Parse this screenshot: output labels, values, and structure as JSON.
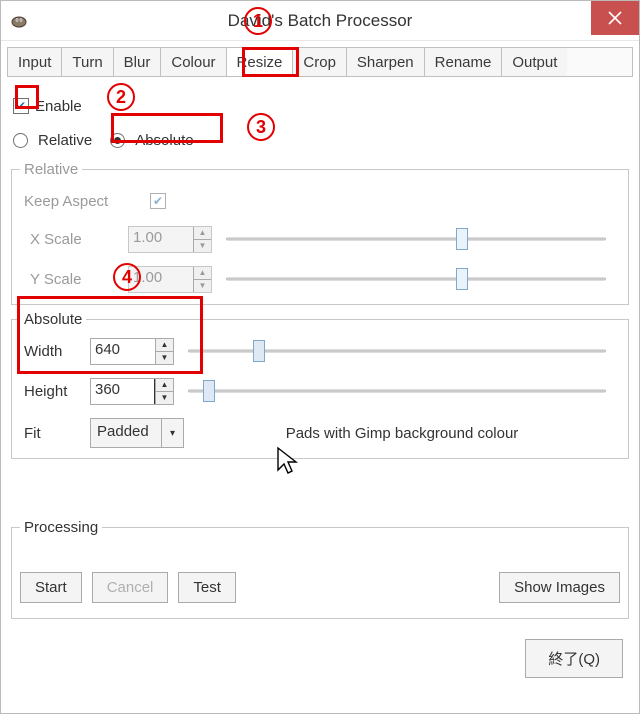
{
  "window": {
    "title": "David's Batch Processor"
  },
  "tabs": [
    "Input",
    "Turn",
    "Blur",
    "Colour",
    "Resize",
    "Crop",
    "Sharpen",
    "Rename",
    "Output"
  ],
  "active_tab": "Resize",
  "resize": {
    "enable_label": "Enable",
    "enable_checked": true,
    "mode_relative_label": "Relative",
    "mode_absolute_label": "Absolute",
    "mode_selected": "Absolute",
    "relative_group": "Relative",
    "keep_aspect_label": "Keep Aspect",
    "keep_aspect_checked": true,
    "xscale_label": "X Scale",
    "xscale_value": "1.00",
    "yscale_label": "Y Scale",
    "yscale_value": "1.00",
    "absolute_group": "Absolute",
    "width_label": "Width",
    "width_value": "640",
    "height_label": "Height",
    "height_value": "360",
    "fit_label": "Fit",
    "fit_value": "Padded",
    "fit_desc": "Pads with Gimp background colour"
  },
  "processing": {
    "group": "Processing",
    "start": "Start",
    "cancel": "Cancel",
    "test": "Test",
    "show_images": "Show Images"
  },
  "footer": {
    "close": "終了(Q)"
  },
  "annotations": {
    "a1": "1",
    "a2": "2",
    "a3": "3",
    "a4": "4"
  }
}
